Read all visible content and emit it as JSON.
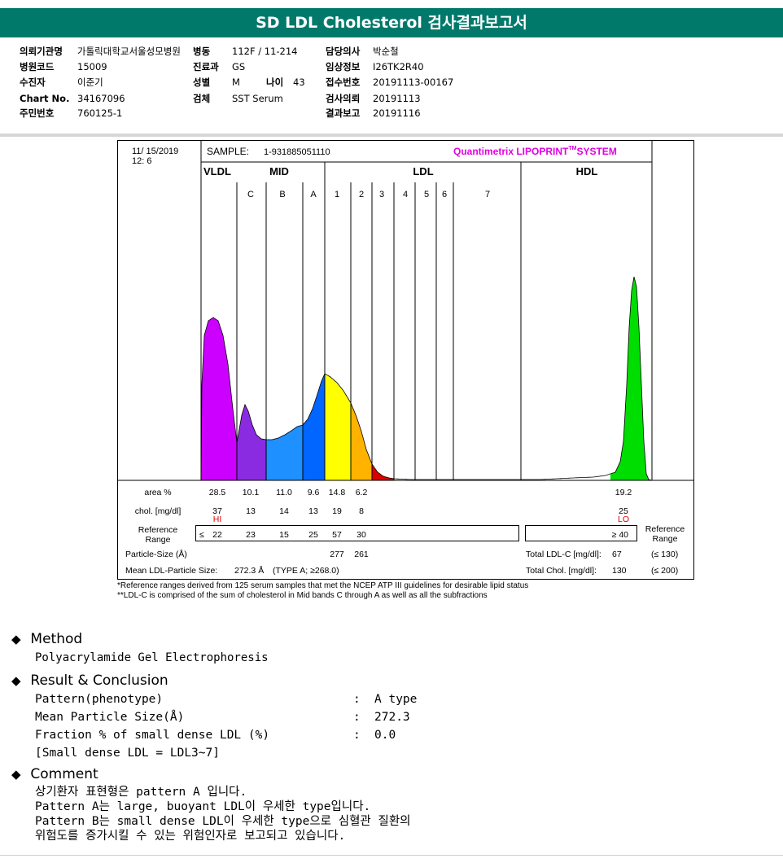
{
  "title": "SD LDL Cholesterol 검사결과보고서",
  "header": {
    "col1": [
      {
        "label": "의뢰기관명",
        "value": "가톨릭대학교서울성모병원"
      },
      {
        "label": "병원코드",
        "value": "15009"
      },
      {
        "label": "수진자",
        "value": "이준기"
      },
      {
        "label": "Chart No.",
        "value": "34167096"
      },
      {
        "label": "주민번호",
        "value": "760125-1"
      }
    ],
    "col2": [
      {
        "label": "병동",
        "value": "112F / 11-214"
      },
      {
        "label": "진료과",
        "value": "GS"
      },
      {
        "label": "성별",
        "value": "M"
      },
      {
        "label": "검체",
        "value": "SST Serum"
      }
    ],
    "age": {
      "label": "나이",
      "value": "43"
    },
    "col3": [
      {
        "label": "담당의사",
        "value": "박순철"
      },
      {
        "label": "임상정보",
        "value": "I26TK2R40"
      },
      {
        "label": "접수번호",
        "value": "20191113-00167"
      },
      {
        "label": "검사의뢰",
        "value": "20191113"
      },
      {
        "label": "결과보고",
        "value": "20191116"
      }
    ]
  },
  "chart": {
    "date": "11/ 15/2019",
    "time": "12:  6",
    "sample_label": "SAMPLE:",
    "sample_id": "1-931885051110",
    "brand": "Quantimetrix LIPOPRINT",
    "brand_tm": "TM",
    "brand_suffix": "SYSTEM",
    "group_vldl": "VLDL",
    "group_mid": "MID",
    "group_ldl": "LDL",
    "group_hdl": "HDL",
    "sub_c": "C",
    "sub_b": "B",
    "sub_a": "A",
    "ldl_subs": [
      "1",
      "2",
      "3",
      "4",
      "5",
      "6",
      "7"
    ],
    "colors": {
      "vldl": "#cc00ff",
      "mid_c": "#8a2be2",
      "mid_b": "#1e90ff",
      "mid_a": "#0066ff",
      "ldl1": "#ffff00",
      "ldl2": "#ffb300",
      "ldl3": "#dd0000",
      "hdl": "#00dd00"
    }
  },
  "chart_data": {
    "type": "table",
    "rows": {
      "area_label": "area %",
      "area": [
        "28.5",
        "10.1",
        "11.0",
        "9.6",
        "14.8",
        "6.2"
      ],
      "area_hdl": "19.2",
      "chol_label": "chol. [mg/dl]",
      "chol": [
        "37",
        "13",
        "14",
        "13",
        "19",
        "8"
      ],
      "chol_hdl": "25",
      "hi_flag": "HI",
      "lo_flag": "LO",
      "ref_label_1": "Reference",
      "ref_label_2": "Range",
      "ref_le": "≤",
      "ref": [
        "22",
        "23",
        "15",
        "25",
        "57",
        "30"
      ],
      "ref_hdl": "≥ 40",
      "ref_right_1": "Reference",
      "ref_right_2": "Range",
      "particle_label": "Particle-Size (Å)",
      "particle_1": "277",
      "particle_2": "261",
      "total_ldl_label": "Total LDL-C [mg/dl]:",
      "total_ldl": "67",
      "total_ldl_ref": "(≤ 130)",
      "mean_label": "Mean LDL-Particle Size:",
      "mean_value": "272.3 Å",
      "mean_type": "(TYPE A; ≥268.0)",
      "total_chol_label": "Total Chol. [mg/dl]:",
      "total_chol": "130",
      "total_chol_ref": "(≤ 200)"
    }
  },
  "notes": {
    "line1": "*Reference ranges derived from 125 serum samples that met the NCEP ATP III guidelines for desirable lipid status",
    "line2": "**LDL-C is comprised of the sum of cholesterol in Mid bands C through A as well as all the subfractions"
  },
  "method": {
    "heading": "Method",
    "text": "Polyacrylamide Gel Electrophoresis"
  },
  "result": {
    "heading": "Result & Conclusion",
    "rows": [
      {
        "label": "Pattern(phenotype)",
        "value": "A type"
      },
      {
        "label": "Mean Particle Size(Å)",
        "value": "272.3"
      },
      {
        "label": "Fraction % of small dense LDL (%)",
        "value": "0.0"
      }
    ],
    "colon": ":",
    "note": "[Small dense LDL = LDL3~7]"
  },
  "comment": {
    "heading": "Comment",
    "lines": [
      "상기환자 표현형은 pattern A 입니다.",
      "Pattern A는 large, buoyant LDL이 우세한 type입니다.",
      "Pattern B는 small dense LDL이 우세한 type으로 심혈관 질환의",
      "위험도를 증가시킬 수 있는 위험인자로 보고되고 있습니다."
    ]
  }
}
